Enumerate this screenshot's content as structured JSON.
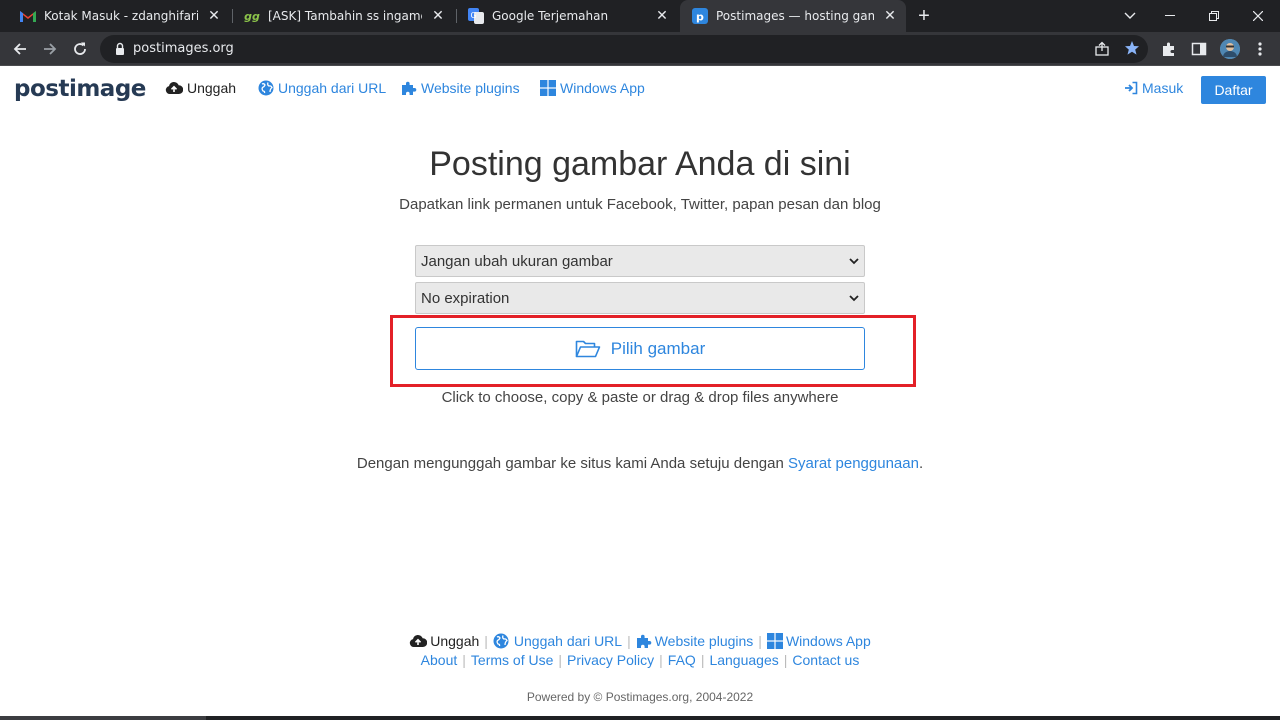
{
  "browser": {
    "tabs": [
      {
        "title": "Kotak Masuk - zdanghifari@gma",
        "icon": "gmail-icon"
      },
      {
        "title": "[ASK] Tambahin ss ingame ke for",
        "icon": "gg-icon"
      },
      {
        "title": "Google Terjemahan",
        "icon": "google-translate-icon"
      },
      {
        "title": "Postimages — hosting gambar g",
        "icon": "postimages-icon"
      }
    ],
    "new_tab": "+",
    "url": "postimages.org"
  },
  "header": {
    "logo": "postimage",
    "nav": {
      "upload": "Unggah",
      "upload_url": "Unggah dari URL",
      "plugins": "Website plugins",
      "windows": "Windows App"
    },
    "login": "Masuk",
    "register": "Daftar"
  },
  "main": {
    "title": "Posting gambar Anda di sini",
    "subtitle": "Dapatkan link permanen untuk Facebook, Twitter, papan pesan dan blog",
    "resize_select": "Jangan ubah ukuran gambar",
    "expiration_select": "No expiration",
    "choose_button": "Pilih gambar",
    "hint": "Click to choose, copy & paste or drag & drop files anywhere",
    "terms_prefix": "Dengan mengunggah gambar ke situs kami Anda setuju dengan ",
    "terms_link": "Syarat penggunaan",
    "terms_suffix": "."
  },
  "footer": {
    "upload": "Unggah",
    "upload_url": "Unggah dari URL",
    "plugins": "Website plugins",
    "windows": "Windows App",
    "about": "About",
    "terms": "Terms of Use",
    "privacy": "Privacy Policy",
    "faq": "FAQ",
    "languages": "Languages",
    "contact": "Contact us",
    "separator": "|",
    "powered": "Powered by © Postimages.org, 2004-2022"
  },
  "colors": {
    "accent": "#2e86de",
    "highlight": "#e32027",
    "logo": "#263a54"
  }
}
